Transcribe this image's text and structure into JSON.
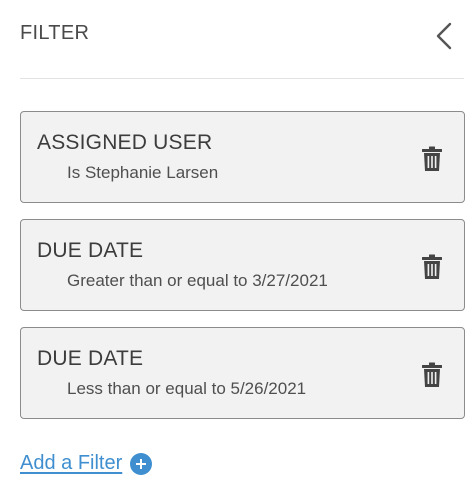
{
  "header": {
    "title": "FILTER",
    "back_icon": "chevron-left-icon"
  },
  "filters": [
    {
      "field": "ASSIGNED USER",
      "condition": "Is Stephanie Larsen",
      "delete_icon": "trash-icon"
    },
    {
      "field": "DUE DATE",
      "condition": "Greater than or equal to 3/27/2021",
      "delete_icon": "trash-icon"
    },
    {
      "field": "DUE DATE",
      "condition": "Less than or equal to 5/26/2021",
      "delete_icon": "trash-icon"
    }
  ],
  "add_filter": {
    "label": "Add a Filter",
    "icon": "plus-circle-icon"
  },
  "colors": {
    "accent": "#3f8fd0",
    "card_background": "#f2f2f2",
    "card_border": "#8c8c8c"
  }
}
